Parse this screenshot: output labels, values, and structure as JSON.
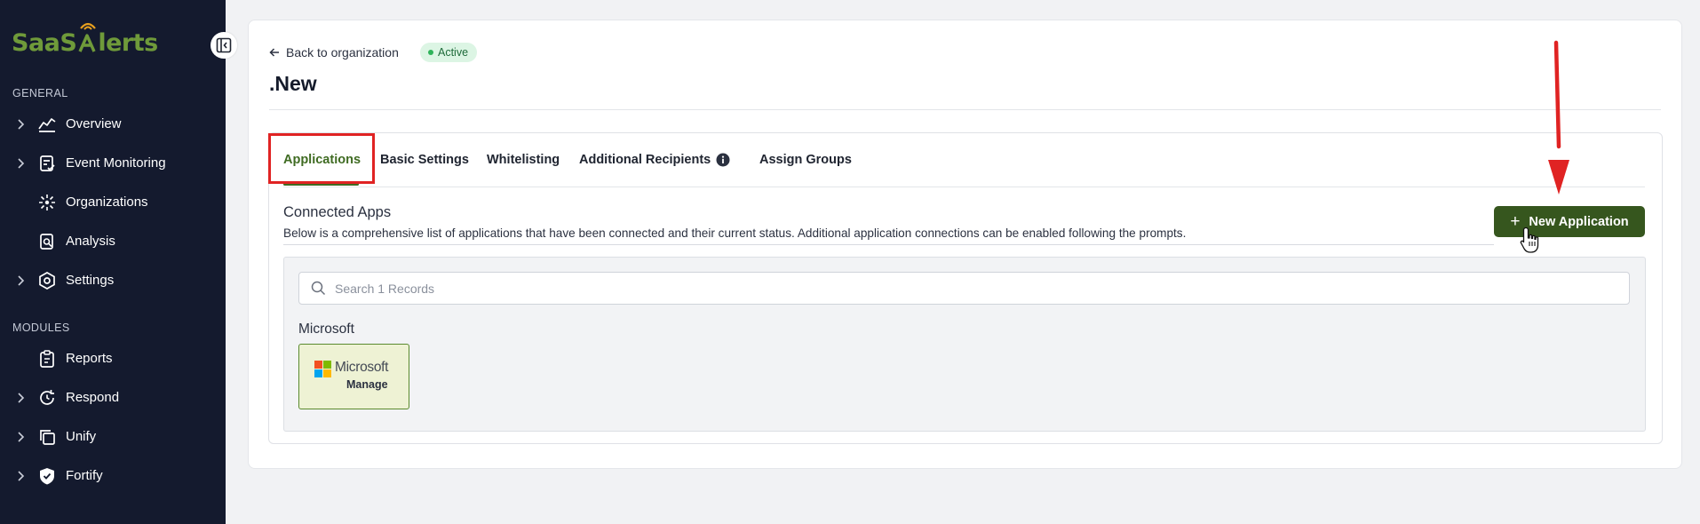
{
  "brand": {
    "name_part1": "SaaS",
    "name_part2": "lerts",
    "accent": "#6f9a3a"
  },
  "sidebar": {
    "sections": [
      {
        "label": "GENERAL",
        "items": [
          {
            "label": "Overview",
            "icon": "chart-line-icon",
            "expandable": true
          },
          {
            "label": "Event Monitoring",
            "icon": "clipboard-check-icon",
            "expandable": true
          },
          {
            "label": "Organizations",
            "icon": "network-icon",
            "expandable": false
          },
          {
            "label": "Analysis",
            "icon": "clipboard-search-icon",
            "expandable": false
          },
          {
            "label": "Settings",
            "icon": "hexagon-gear-icon",
            "expandable": true
          }
        ]
      },
      {
        "label": "MODULES",
        "items": [
          {
            "label": "Reports",
            "icon": "clipboard-icon",
            "expandable": false
          },
          {
            "label": "Respond",
            "icon": "refresh-clock-icon",
            "expandable": true
          },
          {
            "label": "Unify",
            "icon": "copy-icon",
            "expandable": true
          },
          {
            "label": "Fortify",
            "icon": "shield-check-icon",
            "expandable": true
          }
        ]
      }
    ]
  },
  "header": {
    "back_label": "Back to organization",
    "status": "Active",
    "title": ".New"
  },
  "tabs": [
    "Applications",
    "Basic Settings",
    "Whitelisting",
    "Additional Recipients",
    "Assign Groups"
  ],
  "connected": {
    "title": "Connected Apps",
    "description": "Below is a comprehensive list of applications that have been connected and their current status. Additional application connections can be enabled following the prompts.",
    "button_label": "New Application",
    "search_placeholder": "Search 1 Records",
    "group_label": "Microsoft",
    "app": {
      "name": "Microsoft",
      "action": "Manage"
    }
  },
  "colors": {
    "sidebar_bg": "#141a2e",
    "primary_green": "#36561e",
    "active_tab": "#3f6b22",
    "annotation_red": "#e02323"
  }
}
